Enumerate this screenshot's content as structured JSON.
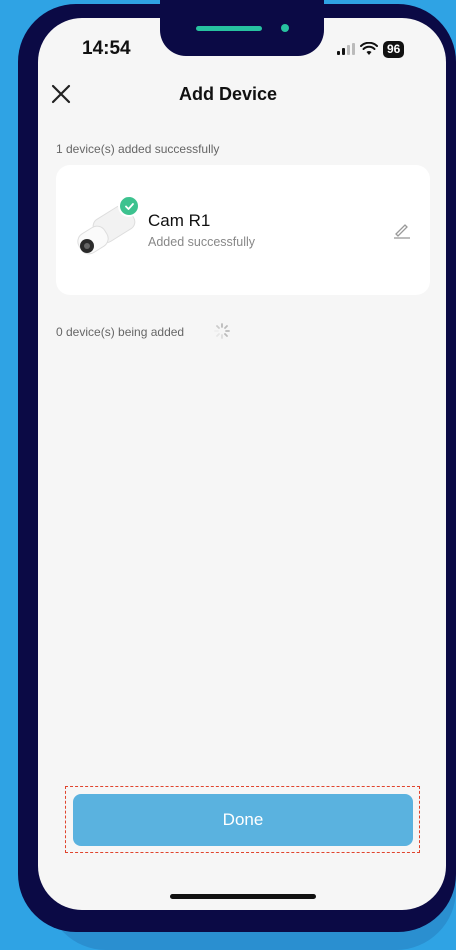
{
  "status_bar": {
    "time": "14:54",
    "battery": "96"
  },
  "header": {
    "title": "Add Device",
    "close_icon": "close-icon"
  },
  "added_section": {
    "label": "1 device(s) added successfully",
    "devices": [
      {
        "name": "Cam R1",
        "status": "Added successfully",
        "badge": "check-icon",
        "edit_icon": "pencil-icon"
      }
    ]
  },
  "pending_section": {
    "label": "0 device(s) being added",
    "spinner_icon": "loading-spinner-icon"
  },
  "footer": {
    "done_label": "Done"
  },
  "colors": {
    "background": "#2fa3e4",
    "phone_frame": "#0b0a45",
    "accent_button": "#5ab2df",
    "success": "#3dc28f",
    "notch_indicator": "#27c2a0"
  }
}
